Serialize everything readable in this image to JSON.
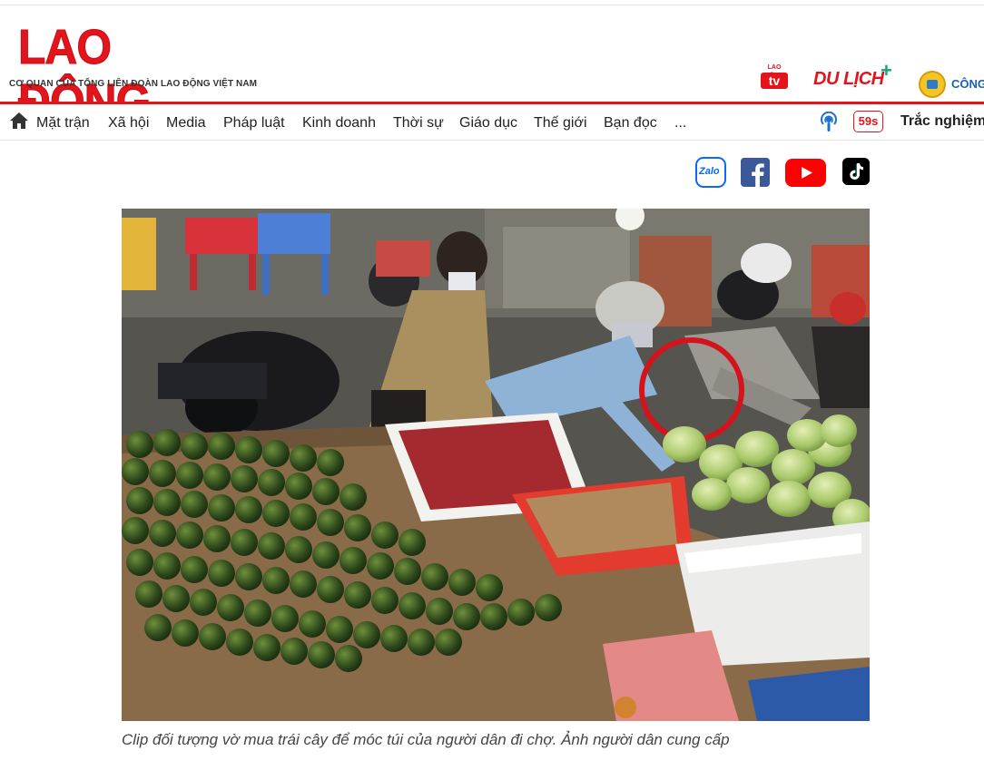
{
  "header": {
    "logo_text": "LAO ĐỘNG",
    "tagline": "CƠ QUAN CỦA TỔNG LIÊN ĐOÀN LAO ĐỘNG VIỆT NAM",
    "brands": {
      "tv_top": "LAO ĐỘNG",
      "tv_label": "tv",
      "dulich_label": "DU LỊCH",
      "cong_label": "CÔNG"
    }
  },
  "nav": {
    "items": [
      "Mặt trận",
      "Xã hội",
      "Media",
      "Pháp luật",
      "Kinh doanh",
      "Thời sự",
      "Giáo dục",
      "Thế giới",
      "Bạn đọc",
      "..."
    ],
    "badge": "59s",
    "quiz_label": "Trắc nghiệm"
  },
  "share": {
    "zalo_label": "Zalo"
  },
  "article": {
    "caption": "Clip đối tượng vờ mua trái cây để móc túi của người dân đi chợ. Ảnh người dân cung cấp"
  },
  "colors": {
    "brand_red": "#e3141b",
    "facebook": "#3b5998",
    "youtube": "#ff0000",
    "tiktok": "#000000",
    "zalo": "#0a68ff"
  },
  "icons": [
    "home-icon",
    "podcast-icon",
    "zalo-icon",
    "facebook-icon",
    "youtube-icon",
    "tiktok-icon"
  ]
}
